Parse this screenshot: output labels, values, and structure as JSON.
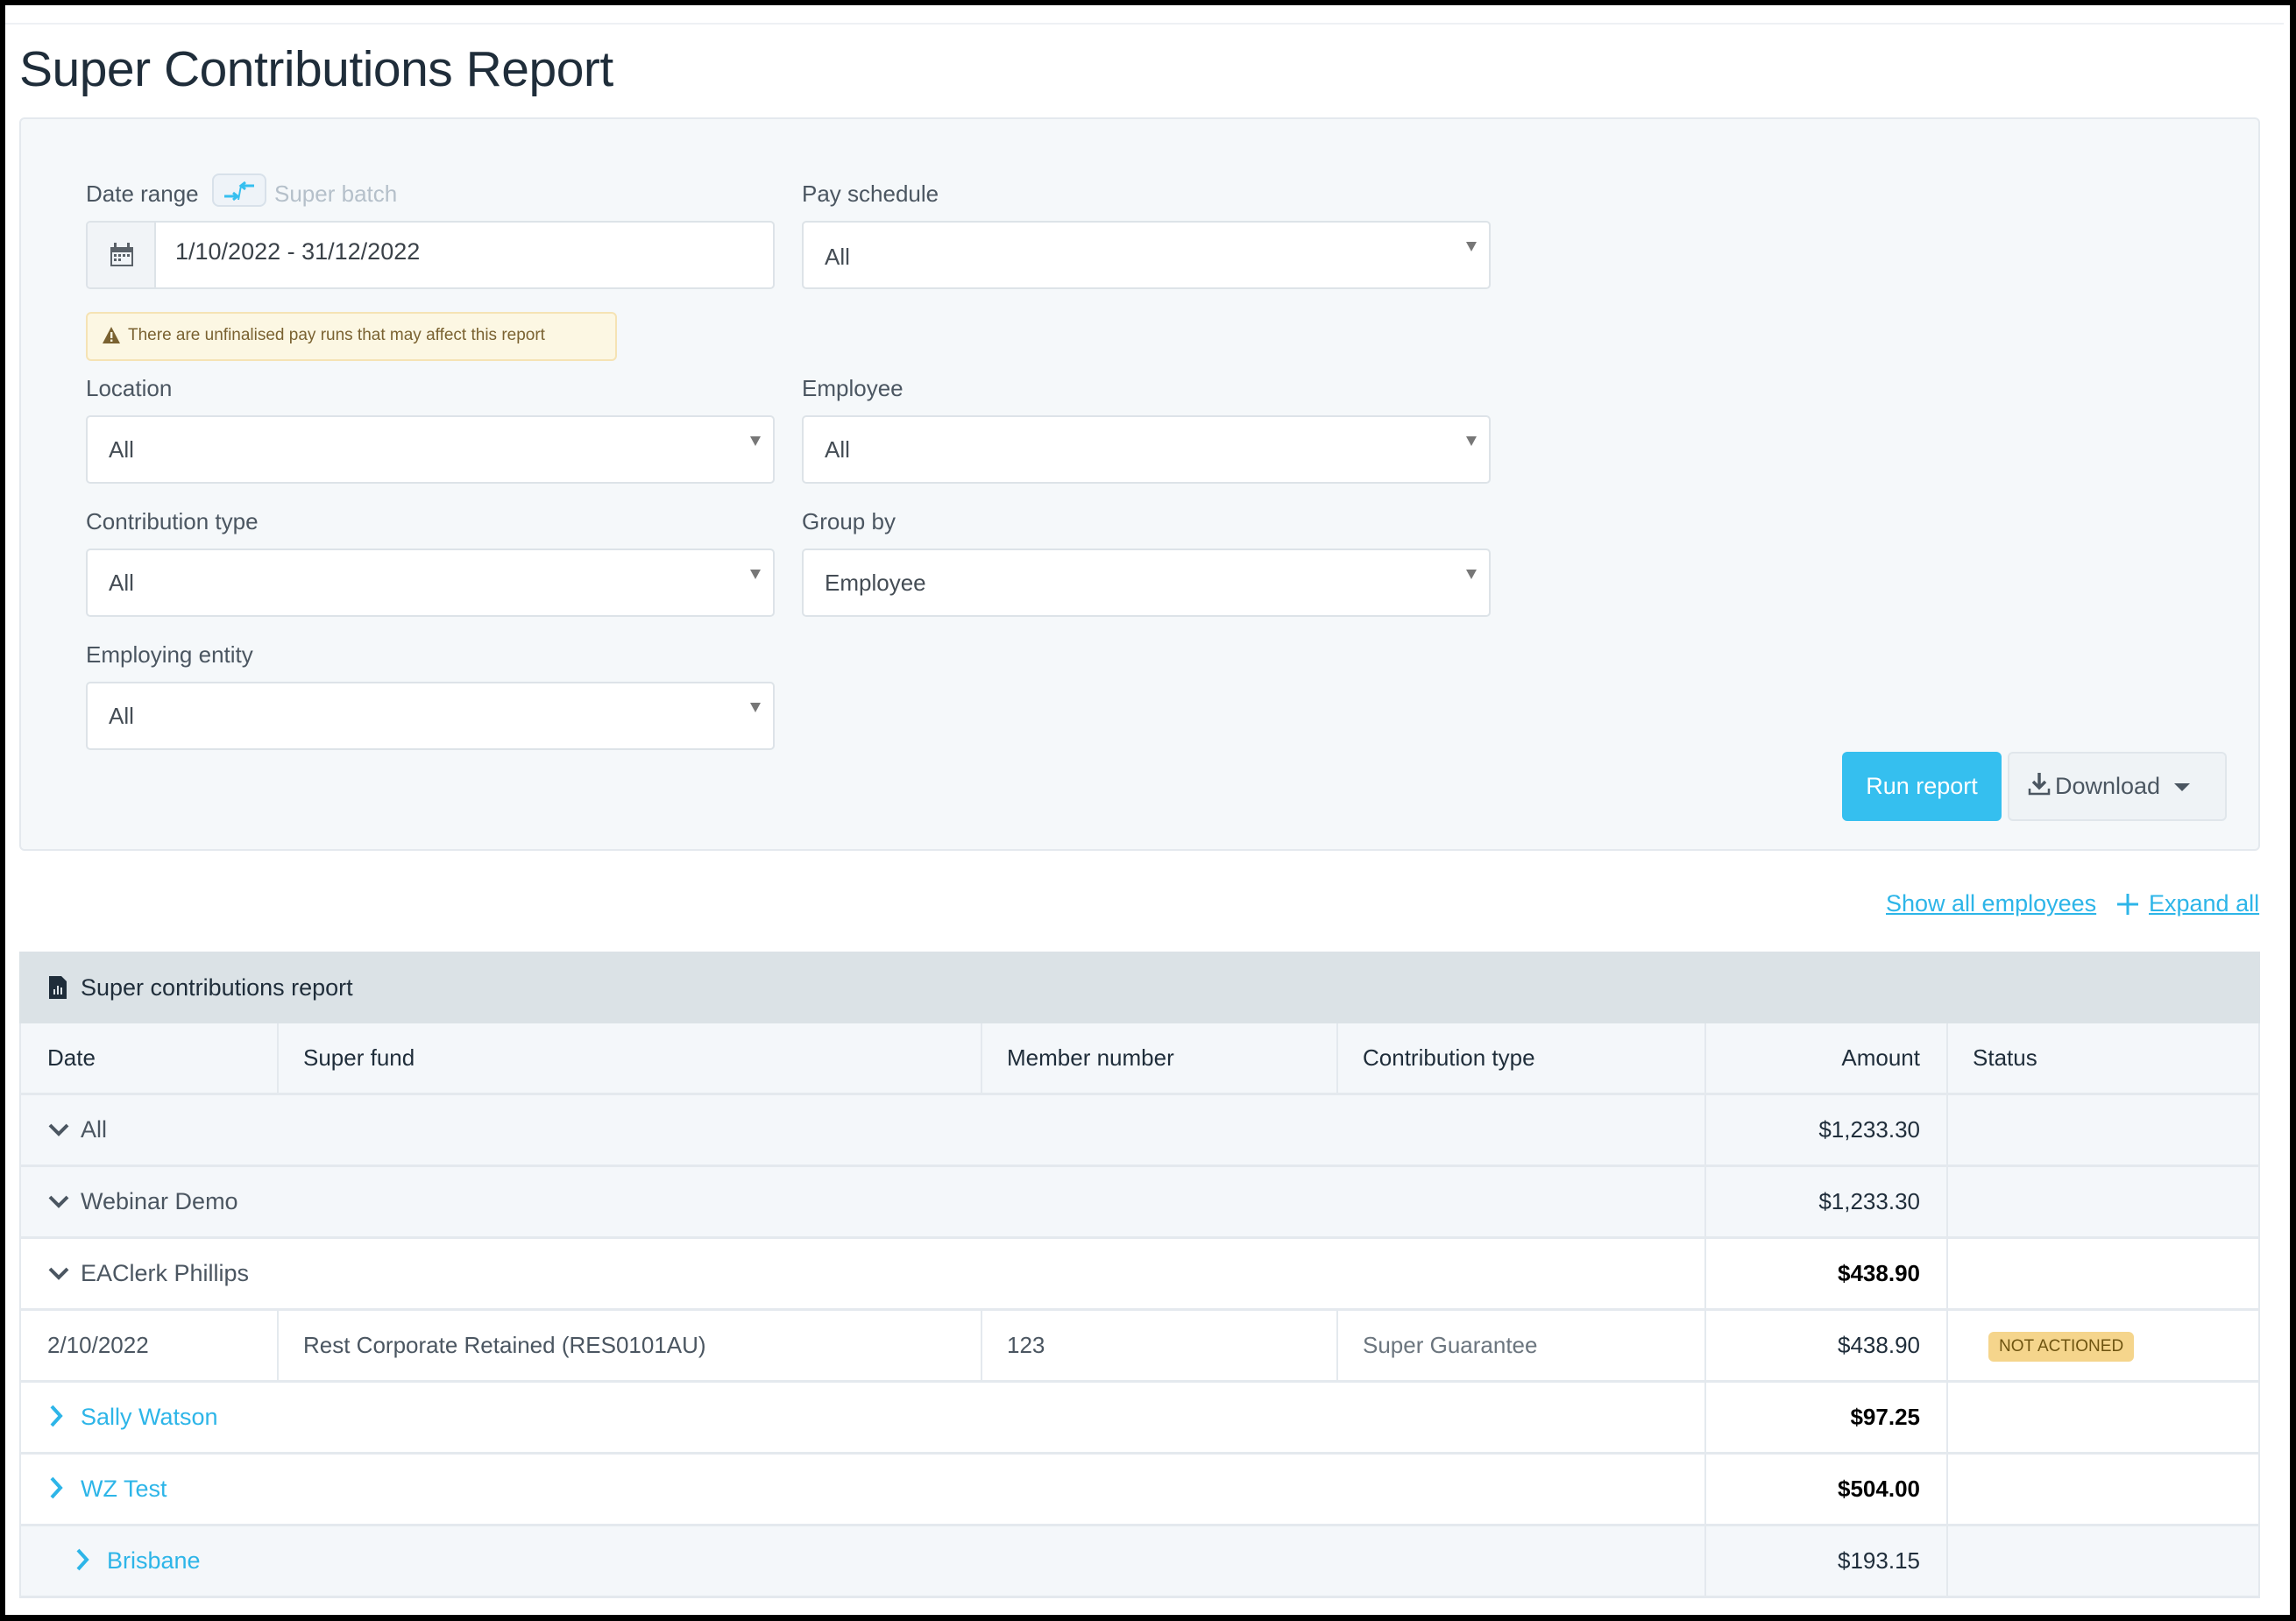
{
  "page": {
    "title": "Super Contributions Report"
  },
  "filters": {
    "date_range_label": "Date range",
    "super_batch_label": "Super batch",
    "date_range_value": "1/10/2022 - 31/12/2022",
    "warning": "There are unfinalised pay runs that may affect this report",
    "pay_schedule": {
      "label": "Pay schedule",
      "value": "All"
    },
    "location": {
      "label": "Location",
      "value": "All"
    },
    "employee": {
      "label": "Employee",
      "value": "All"
    },
    "contribution_type": {
      "label": "Contribution type",
      "value": "All"
    },
    "group_by": {
      "label": "Group by",
      "value": "Employee"
    },
    "employing_entity": {
      "label": "Employing entity",
      "value": "All"
    }
  },
  "actions": {
    "run_report": "Run report",
    "download": "Download",
    "show_all_employees": "Show all employees",
    "expand_all": "Expand all"
  },
  "report": {
    "title": "Super contributions report",
    "columns": [
      "Date",
      "Super fund",
      "Member number",
      "Contribution type",
      "Amount",
      "Status"
    ],
    "rows": [
      {
        "type": "group",
        "level": 0,
        "expanded": true,
        "label": "All",
        "amount": "$1,233.30"
      },
      {
        "type": "group",
        "level": 0,
        "expanded": true,
        "label": "Webinar Demo",
        "amount": "$1,233.30"
      },
      {
        "type": "employee",
        "level": 0,
        "expanded": true,
        "label": "EAClerk Phillips",
        "amount": "$438.90"
      },
      {
        "type": "detail",
        "date": "2/10/2022",
        "super_fund": "Rest Corporate Retained (RES0101AU)",
        "member_number": "123",
        "contribution_type": "Super Guarantee",
        "amount": "$438.90",
        "status": "NOT ACTIONED"
      },
      {
        "type": "employee",
        "level": 0,
        "expanded": false,
        "label": "Sally Watson",
        "amount": "$97.25"
      },
      {
        "type": "employee",
        "level": 0,
        "expanded": false,
        "label": "WZ Test",
        "amount": "$504.00"
      },
      {
        "type": "group",
        "level": 1,
        "expanded": false,
        "label": "Brisbane",
        "amount": "$193.15"
      }
    ]
  },
  "colors": {
    "accent": "#35bfef",
    "link": "#2db5e8",
    "badge_bg": "#f5d58c",
    "warning_bg": "#fcf7e3"
  }
}
